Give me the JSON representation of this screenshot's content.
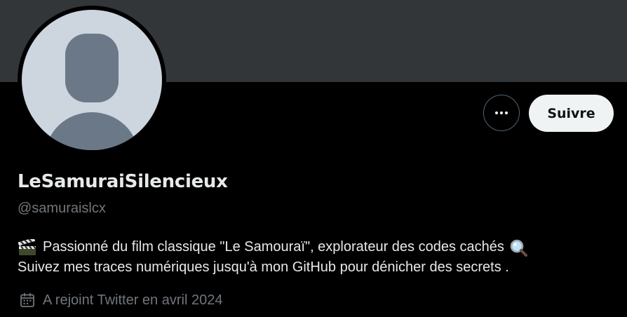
{
  "colors": {
    "background": "#000000",
    "banner": "#333639",
    "primary_text": "#e7e9ea",
    "secondary_text": "#71767b",
    "follow_button_bg": "#eff3f4",
    "follow_button_text": "#0f1419",
    "avatar_bg": "#cdd5de",
    "avatar_silhouette": "#6b7888"
  },
  "profile": {
    "display_name": "LeSamuraiSilencieux",
    "handle": "@samuraislcx",
    "bio_line_1": "Passionné du film classique \"Le Samouraï\", explorateur des codes cachés",
    "bio_line_2": "Suivez mes traces numériques jusqu'à mon GitHub pour dénicher des secrets .",
    "joined": "A rejoint Twitter en avril 2024"
  },
  "actions": {
    "follow_label": "Suivre",
    "more_icon": "more-horizontal-icon"
  },
  "icons": {
    "bio_start": "clapper-board-icon",
    "bio_end": "magnifying-glass-icon",
    "joined": "calendar-icon"
  }
}
